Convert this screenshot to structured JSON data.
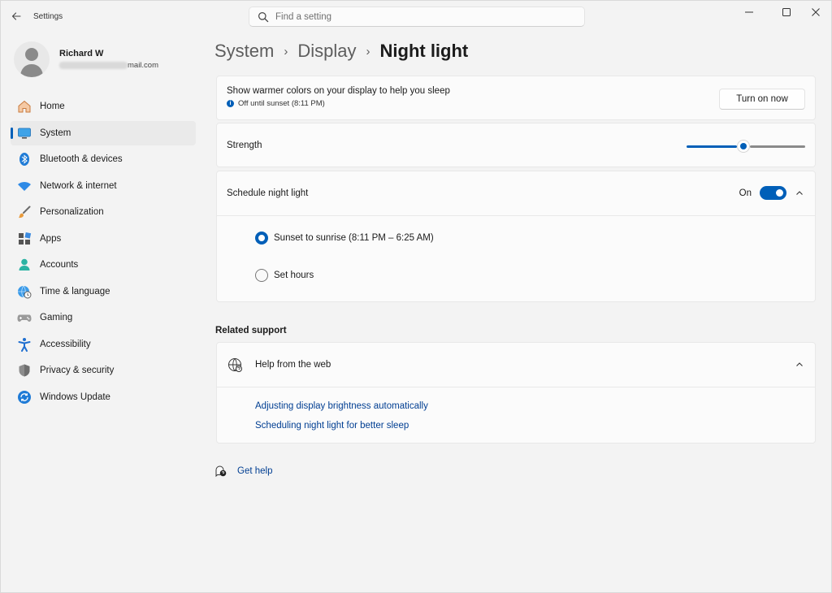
{
  "app": {
    "title": "Settings"
  },
  "search": {
    "placeholder": "Find a setting"
  },
  "profile": {
    "name": "Richard W",
    "email_visible": "mail.com"
  },
  "sidebar": {
    "items": [
      {
        "label": "Home",
        "icon": "home-icon"
      },
      {
        "label": "System",
        "icon": "monitor-icon",
        "active": true
      },
      {
        "label": "Bluetooth & devices",
        "icon": "bluetooth-icon"
      },
      {
        "label": "Network & internet",
        "icon": "wifi-icon"
      },
      {
        "label": "Personalization",
        "icon": "brush-icon"
      },
      {
        "label": "Apps",
        "icon": "apps-icon"
      },
      {
        "label": "Accounts",
        "icon": "person-icon"
      },
      {
        "label": "Time & language",
        "icon": "globe-clock-icon"
      },
      {
        "label": "Gaming",
        "icon": "gamepad-icon"
      },
      {
        "label": "Accessibility",
        "icon": "accessibility-icon"
      },
      {
        "label": "Privacy & security",
        "icon": "shield-icon"
      },
      {
        "label": "Windows Update",
        "icon": "update-icon"
      }
    ]
  },
  "breadcrumb": {
    "items": [
      "System",
      "Display",
      "Night light"
    ],
    "separator": "›"
  },
  "night_light": {
    "description": "Show warmer colors on your display to help you sleep",
    "status": "Off until sunset (8:11 PM)",
    "turn_on_label": "Turn on now"
  },
  "strength": {
    "label": "Strength",
    "value_fraction": 0.48
  },
  "schedule": {
    "label": "Schedule night light",
    "toggle_text": "On",
    "toggle_on": true,
    "options": [
      {
        "label": "Sunset to sunrise (8:11 PM – 6:25 AM)",
        "selected": true
      },
      {
        "label": "Set hours",
        "selected": false
      }
    ]
  },
  "related": {
    "heading": "Related support",
    "help_title": "Help from the web",
    "links": [
      "Adjusting display brightness automatically",
      "Scheduling night light for better sleep"
    ]
  },
  "get_help": {
    "label": "Get help"
  },
  "colors": {
    "accent": "#005fb8",
    "link": "#003e92",
    "background": "#f3f3f3",
    "card": "#fbfbfb"
  }
}
